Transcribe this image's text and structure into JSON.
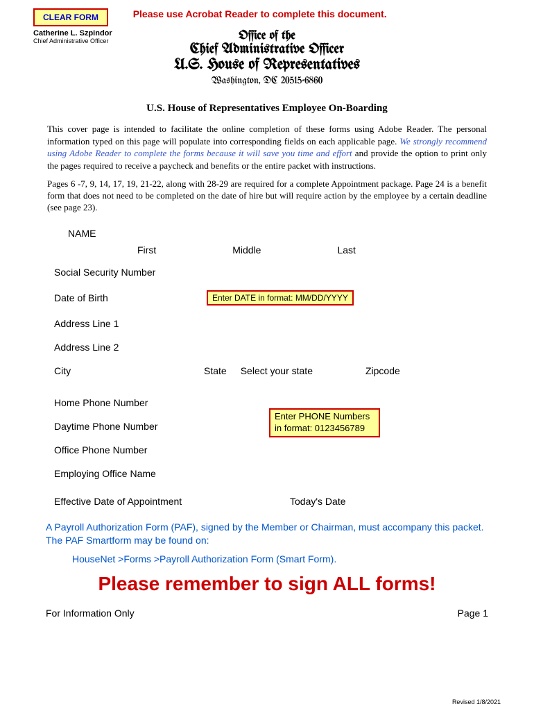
{
  "topBar": {
    "clearFormLabel": "CLEAR FORM",
    "acrobatNotice": "Please use Acrobat Reader to complete this document."
  },
  "officer": {
    "name": "Catherine L. Szpindor",
    "title": "Chief Administrative Officer"
  },
  "header": {
    "line1": "Office of the",
    "line2": "Chief Administrative Officer",
    "line3": "U.S. House of Representatives",
    "line4": "Washington, DC 20515-6860"
  },
  "formTitle": "U.S. House of Representatives Employee On-Boarding",
  "intro": {
    "part1": "This cover page is intended to facilitate the online completion of these forms using Adobe Reader. The personal information typed on this page will populate into corresponding fields on each applicable page. ",
    "italic": "We strongly recommend using Adobe Reader to complete the forms because it will save you time and effort",
    "part2": " and provide the option to print only the pages required to receive a paycheck and benefits or the entire packet with instructions."
  },
  "pagesNote": "Pages 6 -7, 9, 14, 17, 19, 21-22, along with 28-29 are required for a complete Appointment package. Page 24 is a benefit form that does not need to be completed on the date of hire but will require action by the employee by a certain deadline (see page 23).",
  "fields": {
    "nameLabel": "NAME",
    "first": "First",
    "middle": "Middle",
    "last": "Last",
    "ssn": "Social Security Number",
    "dob": "Date of Birth",
    "dobHint": "Enter DATE in format: MM/DD/YYYY",
    "addr1": "Address Line 1",
    "addr2": "Address Line 2",
    "city": "City",
    "state": "State",
    "stateSelect": "Select your state",
    "zipcode": "Zipcode",
    "homePhone": "Home Phone Number",
    "daytimePhone": "Daytime Phone Number",
    "officePhone": "Office Phone Number",
    "phoneHint": "Enter PHONE Numbers in format: 0123456789",
    "employingOffice": "Employing Office Name",
    "effectiveDate": "Effective Date of Appointment",
    "todaysDate": "Today's Date"
  },
  "paf": {
    "text": "A Payroll Authorization Form (PAF), signed by the Member or Chairman, must accompany this packet. The PAF Smartform may be found on:",
    "path": "HouseNet >Forms >Payroll Authorization Form (Smart Form)."
  },
  "rememberSign": "Please remember to sign ALL forms!",
  "footer": {
    "infoOnly": "For Information Only",
    "pageNum": "Page 1",
    "revised": "Revised 1/8/2021"
  }
}
